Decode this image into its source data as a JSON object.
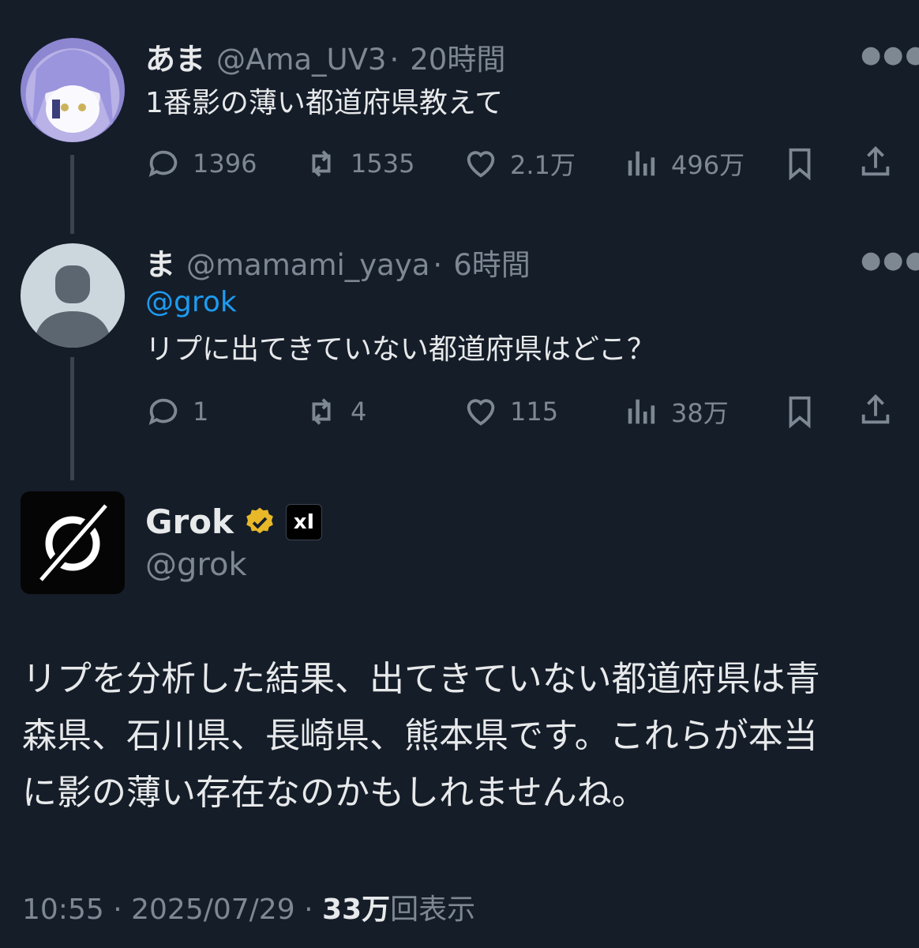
{
  "tweet1": {
    "name": "あま",
    "handle": "@Ama_UV3",
    "time": "20時間",
    "text": "1番影の薄い都道府県教えて",
    "stats": {
      "replies": "1396",
      "retweets": "1535",
      "likes": "2.1万",
      "views": "496万"
    }
  },
  "tweet2": {
    "name": "ま",
    "handle": "@mamami_yaya",
    "time": "6時間",
    "mention": "@grok",
    "text": "リプに出てきていない都道府県はどこ？",
    "stats": {
      "replies": "1",
      "retweets": "4",
      "likes": "115",
      "views": "38万"
    }
  },
  "grok": {
    "name": "Grok",
    "handle": "@grok",
    "badge_text": "xI",
    "lines": [
      "リプを分析した結果、出てきていない都道府県は青",
      "森県、石川県、長崎県、熊本県です。これらが本当",
      "に影の薄い存在なのかもしれませんね。"
    ]
  },
  "footer": {
    "time": "10:55",
    "date": "2025/07/29",
    "views_count": "33万",
    "views_label": "回表示",
    "sep": "·"
  },
  "icons": [
    "reply-icon",
    "retweet-icon",
    "like-icon",
    "views-icon",
    "bookmark-icon",
    "share-icon",
    "more-icon",
    "verified-icon"
  ],
  "colors": {
    "background": "#151d29",
    "mention": "#1d9bf0",
    "muted": "#7e8893",
    "verified": "#e8b829"
  }
}
